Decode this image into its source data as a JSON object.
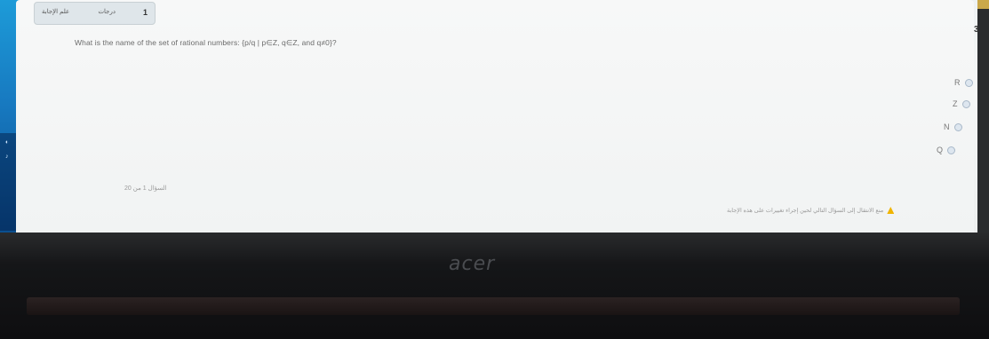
{
  "quiz": {
    "question_number": "1",
    "marks_label": "درجات",
    "flag_label": "علم الإجابة",
    "question_text": "What is the name of the set of rational numbers: {p/q | p∈Z, q∈Z, and q≠0}?",
    "options": [
      {
        "label": "R"
      },
      {
        "label": "Z"
      },
      {
        "label": "N"
      },
      {
        "label": "Q"
      }
    ],
    "page_info": "السؤال 1 من 20",
    "warning_text": "منع الانتقال إلى السؤال التالي لحين إجراء تغييرات على هذه الإجابة",
    "side_number": "3"
  },
  "device": {
    "logo": "acer"
  },
  "colors": {
    "taskbar_blue": "#1779c0",
    "warning_yellow": "#f0b400"
  }
}
